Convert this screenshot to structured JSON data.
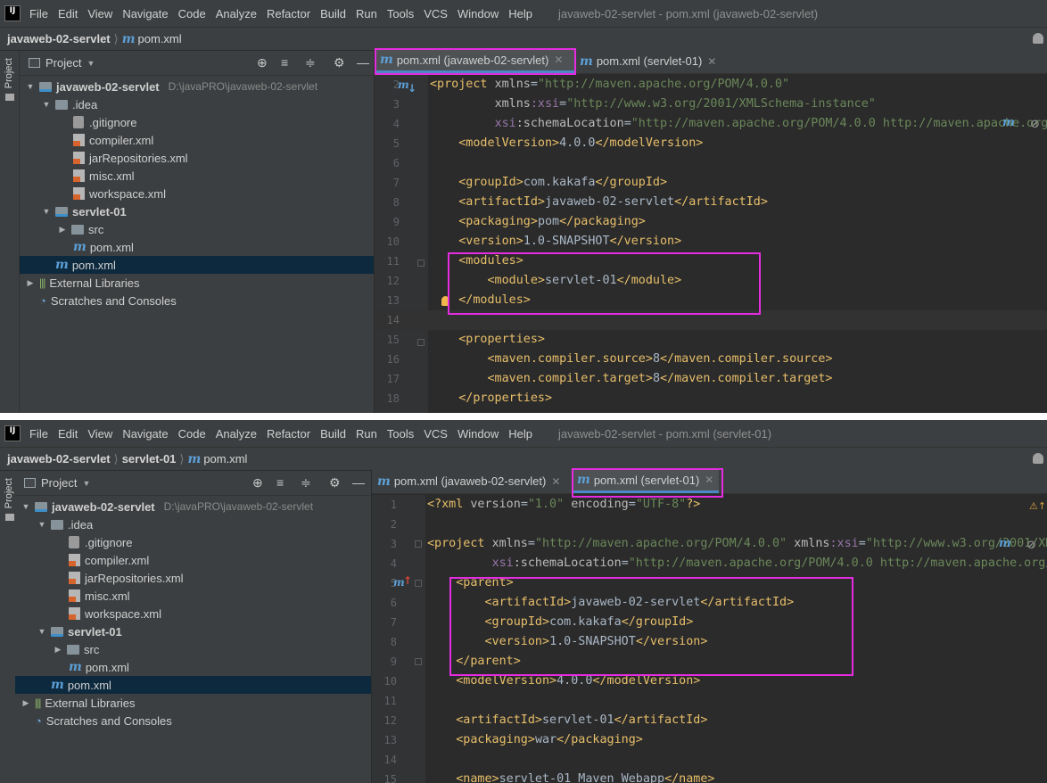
{
  "colors": {
    "accent": "#4a88c7",
    "highlight": "#e52ce0",
    "tag": "#e8bf6a",
    "value": "#6a8759",
    "namespace": "#9876aa",
    "text": "#a9b7c6",
    "selection": "#0d293e"
  },
  "pane1": {
    "menu": {
      "items": [
        "File",
        "Edit",
        "View",
        "Navigate",
        "Code",
        "Analyze",
        "Refactor",
        "Build",
        "Run",
        "Tools",
        "VCS",
        "Window",
        "Help"
      ],
      "window_title": "javaweb-02-servlet - pom.xml (javaweb-02-servlet)"
    },
    "breadcrumb": {
      "project": "javaweb-02-servlet",
      "file": "pom.xml"
    },
    "sidebar_label": "Project",
    "project_header": "Project",
    "tree": {
      "root": "javaweb-02-servlet",
      "root_path": "D:\\javaPRO\\javaweb-02-servlet",
      "idea": ".idea",
      "gitignore": ".gitignore",
      "compiler": "compiler.xml",
      "jarrepo": "jarRepositories.xml",
      "misc": "misc.xml",
      "workspace": "workspace.xml",
      "module": "servlet-01",
      "src": "src",
      "module_pom": "pom.xml",
      "root_pom": "pom.xml",
      "libs": "External Libraries",
      "scratches": "Scratches and Consoles"
    },
    "tabs": [
      {
        "label": "pom.xml (javaweb-02-servlet)",
        "active": true
      },
      {
        "label": "pom.xml (servlet-01)",
        "active": false
      }
    ],
    "code": {
      "lines": [
        {
          "n": "2",
          "p": [
            [
              "tg",
              "<project "
            ],
            [
              "at",
              "xmlns"
            ],
            [
              "tx",
              "="
            ],
            [
              "vl",
              "\"http://maven.apache.org/POM/4.0.0\""
            ]
          ]
        },
        {
          "n": "3",
          "p": [
            [
              "tx",
              "         "
            ],
            [
              "at",
              "xmlns"
            ],
            [
              "ns",
              ":xsi"
            ],
            [
              "tx",
              "="
            ],
            [
              "vl",
              "\"http://www.w3.org/2001/XMLSchema-instance\""
            ]
          ]
        },
        {
          "n": "4",
          "p": [
            [
              "tx",
              "         "
            ],
            [
              "ns",
              "xsi"
            ],
            [
              "at",
              ":schemaLocation"
            ],
            [
              "tx",
              "="
            ],
            [
              "vl",
              "\"http://maven.apache.org/POM/4.0.0 http://maven.apache.org/xsd/maven-4.0.0.xsd\""
            ]
          ]
        },
        {
          "n": "5",
          "p": [
            [
              "tx",
              "    "
            ],
            [
              "tg",
              "<modelVersion>"
            ],
            [
              "tx",
              "4.0.0"
            ],
            [
              "tg",
              "</modelVersion>"
            ]
          ]
        },
        {
          "n": "6",
          "p": []
        },
        {
          "n": "7",
          "p": [
            [
              "tx",
              "    "
            ],
            [
              "tg",
              "<groupId>"
            ],
            [
              "tx",
              "com.kakafa"
            ],
            [
              "tg",
              "</groupId>"
            ]
          ]
        },
        {
          "n": "8",
          "p": [
            [
              "tx",
              "    "
            ],
            [
              "tg",
              "<artifactId>"
            ],
            [
              "tx",
              "javaweb-02-servlet"
            ],
            [
              "tg",
              "</artifactId>"
            ]
          ]
        },
        {
          "n": "9",
          "p": [
            [
              "tx",
              "    "
            ],
            [
              "tg",
              "<packaging>"
            ],
            [
              "tx",
              "pom"
            ],
            [
              "tg",
              "</packaging>"
            ]
          ]
        },
        {
          "n": "10",
          "p": [
            [
              "tx",
              "    "
            ],
            [
              "tg",
              "<version>"
            ],
            [
              "tx",
              "1.0-SNAPSHOT"
            ],
            [
              "tg",
              "</version>"
            ]
          ]
        },
        {
          "n": "11",
          "p": [
            [
              "tx",
              "    "
            ],
            [
              "tg",
              "<modules>"
            ]
          ]
        },
        {
          "n": "12",
          "p": [
            [
              "tx",
              "        "
            ],
            [
              "tg",
              "<module>"
            ],
            [
              "tx",
              "servlet-01"
            ],
            [
              "tg",
              "</module>"
            ]
          ]
        },
        {
          "n": "13",
          "p": [
            [
              "tx",
              "    "
            ],
            [
              "tg",
              "</modules>"
            ]
          ]
        },
        {
          "n": "14",
          "p": []
        },
        {
          "n": "15",
          "p": [
            [
              "tx",
              "    "
            ],
            [
              "tg",
              "<properties>"
            ]
          ]
        },
        {
          "n": "16",
          "p": [
            [
              "tx",
              "        "
            ],
            [
              "tg",
              "<maven.compiler.source>"
            ],
            [
              "tx",
              "8"
            ],
            [
              "tg",
              "</maven.compiler.source>"
            ]
          ]
        },
        {
          "n": "17",
          "p": [
            [
              "tx",
              "        "
            ],
            [
              "tg",
              "<maven.compiler.target>"
            ],
            [
              "tx",
              "8"
            ],
            [
              "tg",
              "</maven.compiler.target>"
            ]
          ]
        },
        {
          "n": "18",
          "p": [
            [
              "tx",
              "    "
            ],
            [
              "tg",
              "</properties>"
            ]
          ]
        }
      ]
    }
  },
  "pane2": {
    "menu": {
      "items": [
        "File",
        "Edit",
        "View",
        "Navigate",
        "Code",
        "Analyze",
        "Refactor",
        "Build",
        "Run",
        "Tools",
        "VCS",
        "Window",
        "Help"
      ],
      "window_title": "javaweb-02-servlet - pom.xml (servlet-01)"
    },
    "breadcrumb": {
      "project": "javaweb-02-servlet",
      "module": "servlet-01",
      "file": "pom.xml"
    },
    "sidebar_label": "Project",
    "project_header": "Project",
    "tree": {
      "root": "javaweb-02-servlet",
      "root_path": "D:\\javaPRO\\javaweb-02-servlet",
      "idea": ".idea",
      "gitignore": ".gitignore",
      "compiler": "compiler.xml",
      "jarrepo": "jarRepositories.xml",
      "misc": "misc.xml",
      "workspace": "workspace.xml",
      "module": "servlet-01",
      "src": "src",
      "module_pom": "pom.xml",
      "root_pom": "pom.xml",
      "libs": "External Libraries",
      "scratches": "Scratches and Consoles"
    },
    "tabs": [
      {
        "label": "pom.xml (javaweb-02-servlet)",
        "active": false
      },
      {
        "label": "pom.xml (servlet-01)",
        "active": true
      }
    ],
    "code": {
      "lines": [
        {
          "n": "1",
          "p": [
            [
              "tg",
              "<?xml "
            ],
            [
              "at",
              "version"
            ],
            [
              "tx",
              "="
            ],
            [
              "vl",
              "\"1.0\""
            ],
            [
              "tx",
              " "
            ],
            [
              "at",
              "encoding"
            ],
            [
              "tx",
              "="
            ],
            [
              "vl",
              "\"UTF-8\""
            ],
            [
              "tg",
              "?>"
            ]
          ]
        },
        {
          "n": "2",
          "p": []
        },
        {
          "n": "3",
          "p": [
            [
              "tg",
              "<project "
            ],
            [
              "at",
              "xmlns"
            ],
            [
              "tx",
              "="
            ],
            [
              "vl",
              "\"http://maven.apache.org/POM/4.0.0\""
            ],
            [
              "tx",
              " "
            ],
            [
              "at",
              "xmlns"
            ],
            [
              "ns",
              ":xsi"
            ],
            [
              "tx",
              "="
            ],
            [
              "vl",
              "\"http://www.w3.org/2001/XMLSchema-instance\""
            ]
          ]
        },
        {
          "n": "4",
          "p": [
            [
              "tx",
              "         "
            ],
            [
              "ns",
              "xsi"
            ],
            [
              "at",
              ":schemaLocation"
            ],
            [
              "tx",
              "="
            ],
            [
              "vl",
              "\"http://maven.apache.org/POM/4.0.0 http://maven.apache.org/xsd/maven-4.0.0.xsd\""
            ]
          ]
        },
        {
          "n": "5",
          "p": [
            [
              "tx",
              "    "
            ],
            [
              "tg",
              "<parent>"
            ]
          ]
        },
        {
          "n": "6",
          "p": [
            [
              "tx",
              "        "
            ],
            [
              "tg",
              "<artifactId>"
            ],
            [
              "tx",
              "javaweb-02-servlet"
            ],
            [
              "tg",
              "</artifactId>"
            ]
          ]
        },
        {
          "n": "7",
          "p": [
            [
              "tx",
              "        "
            ],
            [
              "tg",
              "<groupId>"
            ],
            [
              "tx",
              "com.kakafa"
            ],
            [
              "tg",
              "</groupId>"
            ]
          ]
        },
        {
          "n": "8",
          "p": [
            [
              "tx",
              "        "
            ],
            [
              "tg",
              "<version>"
            ],
            [
              "tx",
              "1.0-SNAPSHOT"
            ],
            [
              "tg",
              "</version>"
            ]
          ]
        },
        {
          "n": "9",
          "p": [
            [
              "tx",
              "    "
            ],
            [
              "tg",
              "</parent>"
            ]
          ]
        },
        {
          "n": "10",
          "p": [
            [
              "tx",
              "    "
            ],
            [
              "tg",
              "<modelVersion>"
            ],
            [
              "tx",
              "4.0.0"
            ],
            [
              "tg",
              "</modelVersion>"
            ]
          ]
        },
        {
          "n": "11",
          "p": []
        },
        {
          "n": "12",
          "p": [
            [
              "tx",
              "    "
            ],
            [
              "tg",
              "<artifactId>"
            ],
            [
              "tx",
              "servlet-01"
            ],
            [
              "tg",
              "</artifactId>"
            ]
          ]
        },
        {
          "n": "13",
          "p": [
            [
              "tx",
              "    "
            ],
            [
              "tg",
              "<packaging>"
            ],
            [
              "tx",
              "war"
            ],
            [
              "tg",
              "</packaging>"
            ]
          ]
        },
        {
          "n": "14",
          "p": []
        },
        {
          "n": "15",
          "p": [
            [
              "tx",
              "    "
            ],
            [
              "tg",
              "<name>"
            ],
            [
              "tx",
              "servlet-01 Maven Webapp"
            ],
            [
              "tg",
              "</name>"
            ]
          ]
        }
      ]
    }
  }
}
